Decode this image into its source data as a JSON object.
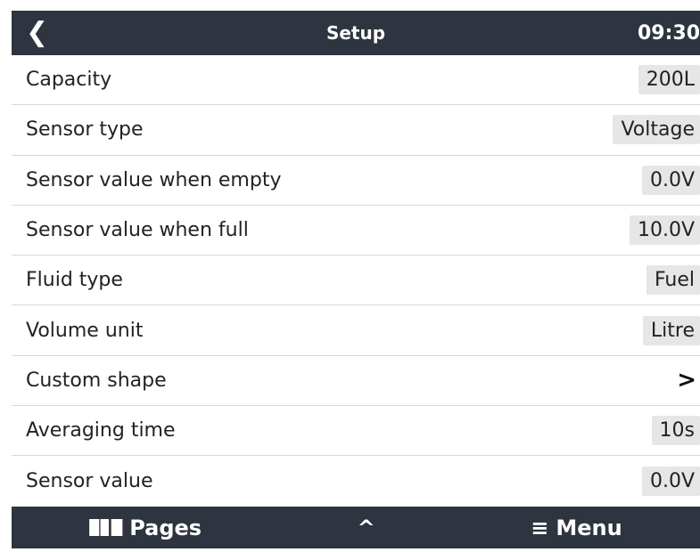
{
  "header": {
    "back_icon": "back-chevron-icon",
    "title": "Setup",
    "clock": "09:30"
  },
  "rows": [
    {
      "label": "Capacity",
      "value": "200L"
    },
    {
      "label": "Sensor type",
      "value": "Voltage"
    },
    {
      "label": "Sensor value when empty",
      "value": "0.0V"
    },
    {
      "label": "Sensor value when full",
      "value": "10.0V"
    },
    {
      "label": "Fluid type",
      "value": "Fuel"
    },
    {
      "label": "Volume unit",
      "value": "Litre"
    },
    {
      "label": "Custom shape",
      "value": ">"
    },
    {
      "label": "Averaging time",
      "value": "10s"
    },
    {
      "label": "Sensor value",
      "value": "0.0V"
    }
  ],
  "footer": {
    "pages_label": "Pages",
    "up_icon": "^",
    "menu_label": "Menu"
  },
  "colors": {
    "bar_bg": "#2e3440",
    "value_bg": "#e6e6e6",
    "divider": "#d7d7d7"
  }
}
